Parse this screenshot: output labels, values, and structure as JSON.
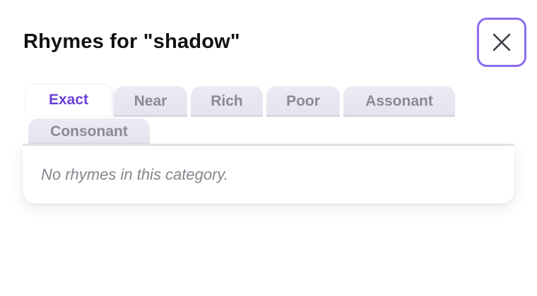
{
  "dialog": {
    "title": "Rhymes for \"shadow\"",
    "close_icon": "close-icon",
    "accent_color": "#8b6cf0"
  },
  "tabs": [
    {
      "label": "Exact",
      "active": true
    },
    {
      "label": "Near",
      "active": false
    },
    {
      "label": "Rich",
      "active": false
    },
    {
      "label": "Poor",
      "active": false
    },
    {
      "label": "Assonant",
      "active": false
    },
    {
      "label": "Consonant",
      "active": false
    }
  ],
  "panel": {
    "empty_message": "No rhymes in this category."
  }
}
